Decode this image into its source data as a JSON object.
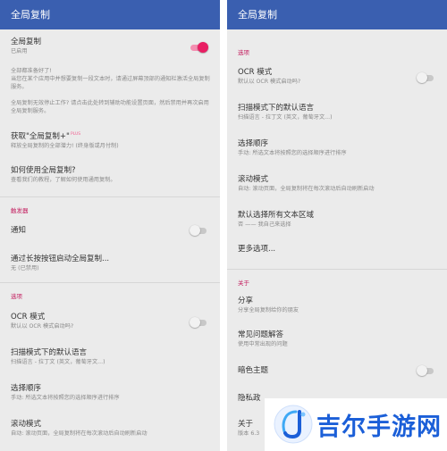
{
  "left": {
    "appbar_title": "全局复制",
    "toggle_row": {
      "title": "全局复制",
      "sub": "已启用",
      "enabled": true
    },
    "info1": "全部都准备好了!\n当您在某个应用中并想要复制一段文本时，请通过屏幕顶部的通知栏激活全局复制服务。",
    "info2": "全局复制无效停止工作? 请点击此处转到辅助功能设置页面，然后禁用并再次启用全局复制服务。",
    "plus_row": {
      "title": "获取\"全局复制+\"",
      "plus": "PLUS",
      "sub": "释放全局复制的全部潜力! (终身版或月付制)"
    },
    "howto_row": {
      "title": "如何使用全局复制?",
      "sub": "查看我们的教程，了解如何使用通用复制。"
    },
    "trigger_section": "触发器",
    "notify_row": {
      "title": "通知",
      "enabled": false
    },
    "longpress_row": {
      "title": "通过长按按钮启动全局复制...",
      "sub": "无 (已禁用)"
    },
    "options_section": "选项",
    "ocr_row": {
      "title": "OCR 模式",
      "sub": "默认以 OCR 模式启动吗?",
      "enabled": false
    },
    "lang_row": {
      "title": "扫描模式下的默认语言",
      "sub": "扫描语言 - 拉丁文 (英文，葡萄牙文...)"
    },
    "order_row": {
      "title": "选择顺序",
      "sub": "手动: 所选文本将按照您的选择顺序进行排序"
    },
    "scroll_row": {
      "title": "滚动模式",
      "sub": "自动: 滚动页面，全局复制将在每次滚动后自动刷新启动"
    }
  },
  "right": {
    "appbar_title": "全局复制",
    "options_section": "选项",
    "ocr_row": {
      "title": "OCR 模式",
      "sub": "默认以 OCR 模式启动吗?",
      "enabled": false
    },
    "lang_row": {
      "title": "扫描模式下的默认语言",
      "sub": "扫描语言 - 拉丁文 (英文，葡萄牙文...)"
    },
    "order_row": {
      "title": "选择顺序",
      "sub": "手动: 所选文本将按照您的选择顺序进行排序"
    },
    "scroll_row": {
      "title": "滚动模式",
      "sub": "自动: 滚动页面，全局复制将在每次滚动后自动刷新启动"
    },
    "selectall_row": {
      "title": "默认选择所有文本区域",
      "sub": "否 —— 我自己来选择"
    },
    "more_row": {
      "title": "更多选项..."
    },
    "about_section": "关于",
    "share_row": {
      "title": "分享",
      "sub": "分享全局复制给你的朋友"
    },
    "faq_row": {
      "title": "常见问题解答",
      "sub": "使用中常出现的问题"
    },
    "dark_row": {
      "title": "暗色主题",
      "enabled": false
    },
    "privacy_row": {
      "title": "隐私政"
    },
    "about_row": {
      "title": "关于",
      "sub": "版本 6.3"
    }
  },
  "watermark": {
    "text": "吉尔手游网",
    "color": "#1b5fd8"
  },
  "colors": {
    "appbar": "#3a5fb0",
    "accent": "#e91e63",
    "section": "#c2185b",
    "background": "#ebebeb"
  }
}
